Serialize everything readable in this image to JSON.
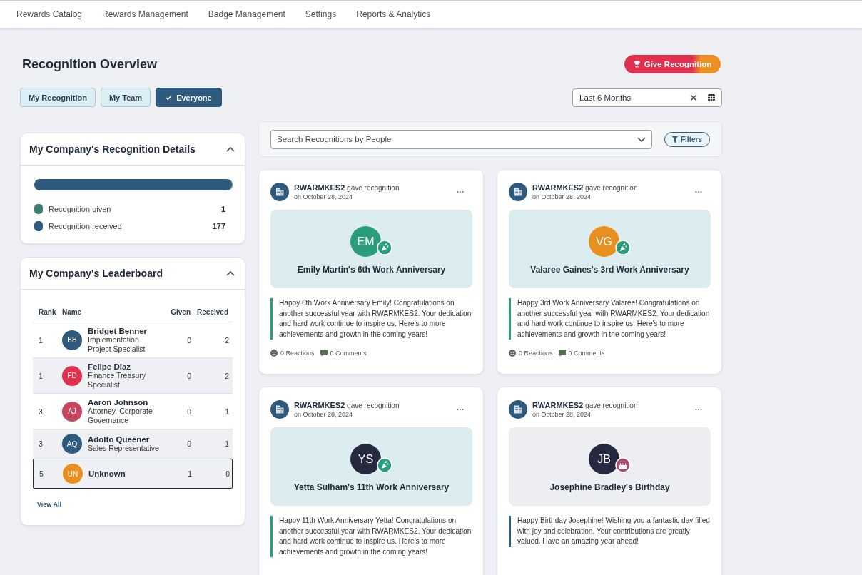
{
  "nav": {
    "items": [
      {
        "label": "Rewards Catalog"
      },
      {
        "label": "Rewards Management"
      },
      {
        "label": "Badge Management"
      },
      {
        "label": "Settings"
      },
      {
        "label": "Reports & Analytics"
      }
    ]
  },
  "header": {
    "title": "Recognition Overview",
    "give_button": "Give Recognition"
  },
  "scope_tabs": [
    {
      "label": "My Recognition",
      "selected": false
    },
    {
      "label": "My Team",
      "selected": false
    },
    {
      "label": "Everyone",
      "selected": true
    }
  ],
  "date_filter": {
    "value": "Last 6 Months"
  },
  "recognition_details": {
    "title": "My Company's Recognition Details",
    "expanded": true,
    "bar": {
      "level": 0.994
    },
    "legend": [
      {
        "label": "Recognition given",
        "value": "1",
        "color": "#3b7a70"
      },
      {
        "label": "Recognition received",
        "value": "177",
        "color": "#2e5a7e"
      }
    ]
  },
  "leaderboard": {
    "title": "My Company's Leaderboard",
    "expanded": true,
    "columns": [
      "Rank",
      "Name",
      "Given",
      "Received"
    ],
    "rows": [
      {
        "rank": "1",
        "initials": "BB",
        "color": "#2e5a7e",
        "name": "Bridget Benner",
        "role": "Implementation Project Specialist",
        "given": "0",
        "received": "2",
        "highlighted": false
      },
      {
        "rank": "1",
        "initials": "FD",
        "color": "#e0304e",
        "name": "Felipe Diaz",
        "role": "Finance Treasury Specialist",
        "given": "0",
        "received": "2",
        "highlighted": false
      },
      {
        "rank": "3",
        "initials": "AJ",
        "color": "#c4465f",
        "name": "Aaron Johnson",
        "role": "Attorney, Corporate Governance",
        "given": "0",
        "received": "1",
        "highlighted": false
      },
      {
        "rank": "3",
        "initials": "AQ",
        "color": "#2e5a7e",
        "name": "Adolfo Queener",
        "role": "Sales Representative",
        "given": "0",
        "received": "1",
        "highlighted": false
      },
      {
        "rank": "5",
        "initials": "UN",
        "color": "#e8901f",
        "name": "Unknown",
        "given": "1",
        "received": "0",
        "highlighted": true
      }
    ],
    "view_all": "View All"
  },
  "search": {
    "placeholder": "Search Recognitions by People",
    "filters_button": "Filters"
  },
  "feed": [
    {
      "kind": "work_anniversary",
      "headline": "**RWARMKES2** gave recognition",
      "date": "on October 28, 2024",
      "initials": "EM",
      "color": "#2a9d7a",
      "title": "Emily Martin's 6th Work Anniversary",
      "message": "Happy 6th Work Anniversary Emily! Congratulations on another successful year with RWARMKES2. Your dedication and hard work continue to inspire us. Here's to more achievements and growth in the coming years!",
      "reactions": "0 Reactions",
      "comments": "0 Comments"
    },
    {
      "kind": "work_anniversary",
      "headline": "**RWARMKES2** gave recognition",
      "date": "on October 28, 2024",
      "initials": "VG",
      "color": "#e8901f",
      "title": "Valaree Gaines's 3rd Work Anniversary",
      "message": "Happy 3rd Work Anniversary Valaree! Congratulations on another successful year with RWARMKES2. Your dedication and hard work continue to inspire us. Here's to more achievements and growth in the coming years!",
      "reactions": "0 Reactions",
      "comments": "0 Comments"
    },
    {
      "kind": "work_anniversary",
      "headline": "**RWARMKES2** gave recognition",
      "date": "on October 28, 2024",
      "initials": "YS",
      "color": "#262a40",
      "title": "Yetta Sulham's 11th Work Anniversary",
      "message": "Happy 11th Work Anniversary Yetta! Congratulations on another successful year with RWARMKES2. Your dedication and hard work continue to inspire us. Here's to more achievements and growth in the coming years!"
    },
    {
      "kind": "birthday",
      "headline": "**RWARMKES2** gave recognition",
      "date": "on October 28, 2024",
      "initials": "JB",
      "color": "#262a40",
      "title": "Josephine Bradley's Birthday",
      "message": "Happy Birthday Josephine! Wishing you a fantastic day filled with joy and celebration. Your contributions are greatly valued. Have an amazing year ahead!"
    }
  ]
}
